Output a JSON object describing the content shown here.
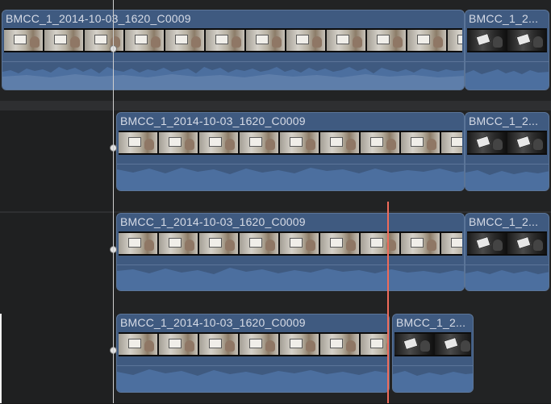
{
  "timeline": {
    "rows": [
      {
        "primary_clip_title": "BMCC_1_2014-10-03_1620_C0009",
        "secondary_clip_title": "BMCC_1_2..."
      },
      {
        "primary_clip_title": "BMCC_1_2014-10-03_1620_C0009",
        "secondary_clip_title": "BMCC_1_2..."
      },
      {
        "primary_clip_title": "BMCC_1_2014-10-03_1620_C0009",
        "secondary_clip_title": "BMCC_1_2..."
      },
      {
        "primary_clip_title": "BMCC_1_2014-10-03_1620_C0009",
        "secondary_clip_title": "BMCC_1_2..."
      }
    ],
    "colors": {
      "clip_blue": "#3f5a80",
      "audio_blue": "#4c6f9f",
      "skimmer_red": "#f06b5a",
      "playhead_white": "#cfcfcf"
    }
  }
}
